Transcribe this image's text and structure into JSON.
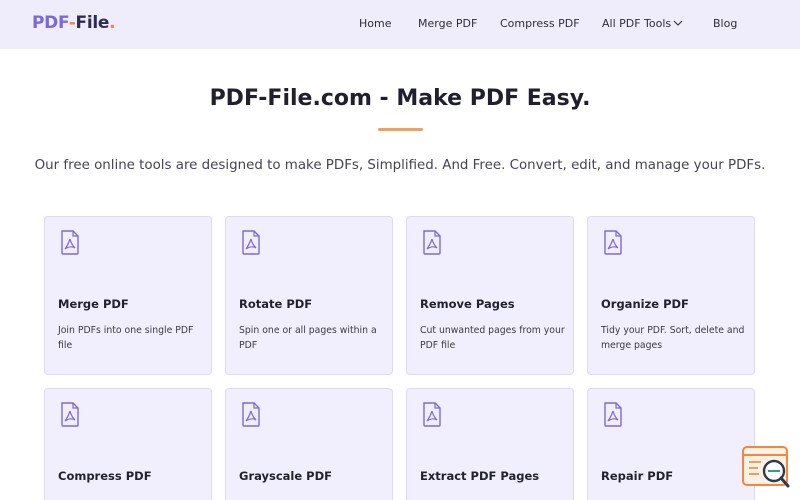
{
  "header": {
    "logo": {
      "part1": "PDF",
      "dash": "-",
      "part2": "File",
      "dot": "."
    },
    "nav": [
      {
        "label": "Home"
      },
      {
        "label": "Merge PDF"
      },
      {
        "label": "Compress PDF"
      },
      {
        "label": "All PDF Tools"
      },
      {
        "label": "Blog"
      }
    ]
  },
  "hero": {
    "title": "PDF-File.com - Make PDF Easy.",
    "subtitle": "Our free online tools are designed to make PDFs, Simplified. And Free. Convert, edit, and manage your PDFs."
  },
  "tools": [
    {
      "name": "Merge PDF",
      "desc": "Join PDFs into one single PDF file",
      "icon": "pdf-file-icon"
    },
    {
      "name": "Rotate PDF",
      "desc": "Spin one or all pages within a PDF",
      "icon": "pdf-file-icon"
    },
    {
      "name": "Remove Pages",
      "desc": "Cut unwanted pages from your PDF file",
      "icon": "pdf-file-icon"
    },
    {
      "name": "Organize PDF",
      "desc": "Tidy your PDF. Sort, delete and merge pages",
      "icon": "pdf-file-icon"
    },
    {
      "name": "Compress PDF",
      "desc": "",
      "icon": "pdf-file-icon"
    },
    {
      "name": "Grayscale PDF",
      "desc": "",
      "icon": "pdf-file-icon"
    },
    {
      "name": "Extract PDF Pages",
      "desc": "",
      "icon": "pdf-file-icon"
    },
    {
      "name": "Repair PDF",
      "desc": "",
      "icon": "pdf-file-icon"
    }
  ],
  "colors": {
    "accent": "#7a6ad8",
    "brand_dark": "#2e2c55",
    "orange": "#f0883e",
    "header_bg": "#efedfb",
    "card_bg": "#f1effd"
  }
}
